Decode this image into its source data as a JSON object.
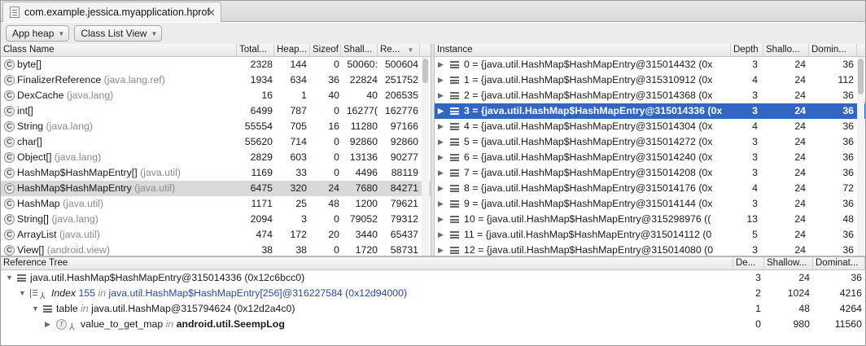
{
  "tab": {
    "title": "com.example.jessica.myapplication.hprof",
    "close_glyph": "✕"
  },
  "toolbar": {
    "heap_combo": "App heap",
    "view_combo": "Class List View"
  },
  "class_table": {
    "headers": [
      "Class Name",
      "Total...",
      "Heap...",
      "Sizeof",
      "Shall...",
      "Re..."
    ],
    "rows": [
      {
        "name": "byte[]",
        "pkg": "",
        "total": "2328",
        "heap": "144",
        "sizeof": "0",
        "shallow": "50060:",
        "retained": "500604"
      },
      {
        "name": "FinalizerReference",
        "pkg": "(java.lang.ref)",
        "total": "1934",
        "heap": "634",
        "sizeof": "36",
        "shallow": "22824",
        "retained": "251752"
      },
      {
        "name": "DexCache",
        "pkg": "(java.lang)",
        "total": "16",
        "heap": "1",
        "sizeof": "40",
        "shallow": "40",
        "retained": "206535"
      },
      {
        "name": "int[]",
        "pkg": "",
        "total": "6499",
        "heap": "787",
        "sizeof": "0",
        "shallow": "16277(",
        "retained": "162776"
      },
      {
        "name": "String",
        "pkg": "(java.lang)",
        "total": "55554",
        "heap": "705",
        "sizeof": "16",
        "shallow": "11280",
        "retained": "97166"
      },
      {
        "name": "char[]",
        "pkg": "",
        "total": "55620",
        "heap": "714",
        "sizeof": "0",
        "shallow": "92860",
        "retained": "92860"
      },
      {
        "name": "Object[]",
        "pkg": "(java.lang)",
        "total": "2829",
        "heap": "603",
        "sizeof": "0",
        "shallow": "13136",
        "retained": "90277"
      },
      {
        "name": "HashMap$HashMapEntry[]",
        "pkg": "(java.util)",
        "total": "1169",
        "heap": "33",
        "sizeof": "0",
        "shallow": "4496",
        "retained": "88119"
      },
      {
        "name": "HashMap$HashMapEntry",
        "pkg": "(java.util)",
        "total": "6475",
        "heap": "320",
        "sizeof": "24",
        "shallow": "7680",
        "retained": "84271",
        "selected": true
      },
      {
        "name": "HashMap",
        "pkg": "(java.util)",
        "total": "1171",
        "heap": "25",
        "sizeof": "48",
        "shallow": "1200",
        "retained": "79621"
      },
      {
        "name": "String[]",
        "pkg": "(java.lang)",
        "total": "2094",
        "heap": "3",
        "sizeof": "0",
        "shallow": "79052",
        "retained": "79312"
      },
      {
        "name": "ArrayList",
        "pkg": "(java.util)",
        "total": "474",
        "heap": "172",
        "sizeof": "20",
        "shallow": "3440",
        "retained": "65437"
      },
      {
        "name": "View[]",
        "pkg": "(android.view)",
        "total": "38",
        "heap": "38",
        "sizeof": "0",
        "shallow": "1720",
        "retained": "58731"
      }
    ]
  },
  "instance_table": {
    "headers": [
      "Instance",
      "Depth",
      "Shallo...",
      "Domin..."
    ],
    "rows": [
      {
        "label": "0 = {java.util.HashMap$HashMapEntry@315014432 (0x",
        "depth": "3",
        "shallow": "24",
        "dominating": "36"
      },
      {
        "label": "1 = {java.util.HashMap$HashMapEntry@315310912 (0x",
        "depth": "4",
        "shallow": "24",
        "dominating": "112"
      },
      {
        "label": "2 = {java.util.HashMap$HashMapEntry@315014368 (0x",
        "depth": "3",
        "shallow": "24",
        "dominating": "36"
      },
      {
        "label": "3 = {java.util.HashMap$HashMapEntry@315014336 (0x",
        "depth": "3",
        "shallow": "24",
        "dominating": "36",
        "selected": true
      },
      {
        "label": "4 = {java.util.HashMap$HashMapEntry@315014304 (0x",
        "depth": "4",
        "shallow": "24",
        "dominating": "36"
      },
      {
        "label": "5 = {java.util.HashMap$HashMapEntry@315014272 (0x",
        "depth": "3",
        "shallow": "24",
        "dominating": "36"
      },
      {
        "label": "6 = {java.util.HashMap$HashMapEntry@315014240 (0x",
        "depth": "3",
        "shallow": "24",
        "dominating": "36"
      },
      {
        "label": "7 = {java.util.HashMap$HashMapEntry@315014208 (0x",
        "depth": "3",
        "shallow": "24",
        "dominating": "36"
      },
      {
        "label": "8 = {java.util.HashMap$HashMapEntry@315014176 (0x",
        "depth": "4",
        "shallow": "24",
        "dominating": "72"
      },
      {
        "label": "9 = {java.util.HashMap$HashMapEntry@315014144 (0x",
        "depth": "3",
        "shallow": "24",
        "dominating": "36"
      },
      {
        "label": "10 = {java.util.HashMap$HashMapEntry@315298976 ((",
        "depth": "13",
        "shallow": "24",
        "dominating": "48"
      },
      {
        "label": "11 = {java.util.HashMap$HashMapEntry@315014112 (0",
        "depth": "5",
        "shallow": "24",
        "dominating": "36"
      },
      {
        "label": "12 = {java.util.HashMap$HashMapEntry@315014080 (0",
        "depth": "3",
        "shallow": "24",
        "dominating": "36"
      }
    ]
  },
  "reference_tree": {
    "headers": [
      "Reference Tree",
      "De...",
      "Shallow...",
      "Dominat..."
    ],
    "rows": [
      {
        "level": 0,
        "kind": "instance",
        "text": "java.util.HashMap$HashMapEntry@315014336 (0x12c6bcc0)",
        "depth": "3",
        "shallow": "24",
        "dominating": "36"
      },
      {
        "level": 1,
        "kind": "index",
        "prefix": "Index",
        "field": "155",
        "in": "in",
        "owner": "java.util.HashMap$HashMapEntry[256]@316227584 (0x12d94000)",
        "depth": "2",
        "shallow": "1024",
        "dominating": "4216"
      },
      {
        "level": 2,
        "kind": "field",
        "field": "table",
        "in": "in",
        "owner": "java.util.HashMap@315794624 (0x12d2a4c0)",
        "depth": "1",
        "shallow": "48",
        "dominating": "4264"
      },
      {
        "level": 3,
        "kind": "static",
        "field": "value_to_get_map",
        "in": "in",
        "owner": "android.util.SeempLog",
        "depth": "0",
        "shallow": "980",
        "dominating": "11560"
      }
    ]
  }
}
